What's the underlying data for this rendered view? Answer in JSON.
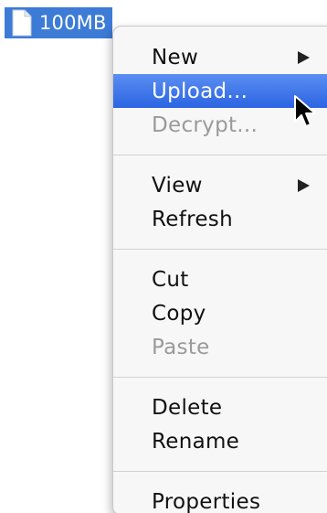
{
  "file": {
    "name": "100MB",
    "icon": "document-icon"
  },
  "menu": {
    "groups": [
      [
        {
          "label": "New",
          "submenu": true,
          "disabled": false,
          "highlighted": false
        },
        {
          "label": "Upload...",
          "submenu": false,
          "disabled": false,
          "highlighted": true
        },
        {
          "label": "Decrypt...",
          "submenu": false,
          "disabled": true,
          "highlighted": false
        }
      ],
      [
        {
          "label": "View",
          "submenu": true,
          "disabled": false,
          "highlighted": false
        },
        {
          "label": "Refresh",
          "submenu": false,
          "disabled": false,
          "highlighted": false
        }
      ],
      [
        {
          "label": "Cut",
          "submenu": false,
          "disabled": false,
          "highlighted": false
        },
        {
          "label": "Copy",
          "submenu": false,
          "disabled": false,
          "highlighted": false
        },
        {
          "label": "Paste",
          "submenu": false,
          "disabled": true,
          "highlighted": false
        }
      ],
      [
        {
          "label": "Delete",
          "submenu": false,
          "disabled": false,
          "highlighted": false
        },
        {
          "label": "Rename",
          "submenu": false,
          "disabled": false,
          "highlighted": false
        }
      ],
      [
        {
          "label": "Properties",
          "submenu": false,
          "disabled": false,
          "highlighted": false
        }
      ]
    ]
  },
  "colors": {
    "selection": "#3c7bd6",
    "highlight": "#2a64e2",
    "disabled_text": "#9a9a9a"
  }
}
